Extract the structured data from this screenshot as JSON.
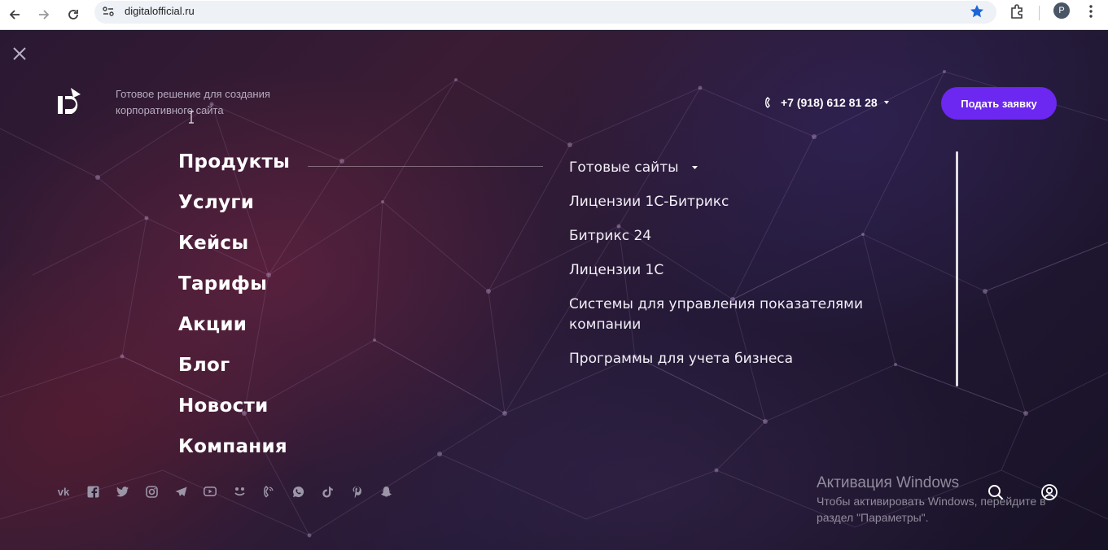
{
  "browser": {
    "url": "digitalofficial.ru",
    "profile_initial": "P"
  },
  "header": {
    "tagline_line1": "Готовое решение для создания",
    "tagline_line2": "корпоративного сайта",
    "phone": "+7 (918) 612 81 28",
    "cta_label": "Подать заявку"
  },
  "main_menu": {
    "items": [
      "Продукты",
      "Услуги",
      "Кейсы",
      "Тарифы",
      "Акции",
      "Блог",
      "Новости",
      "Компания"
    ]
  },
  "sub_menu": {
    "items": [
      "Готовые сайты",
      "Лицензии 1С-Битрикс",
      "Битрикс 24",
      "Лицензии 1С",
      "Системы для управления показателями компании",
      "Программы для учета бизнеса"
    ]
  },
  "socials": {
    "icons": [
      "vk-icon",
      "facebook-icon",
      "twitter-icon",
      "instagram-icon",
      "telegram-icon",
      "youtube-icon",
      "odnoklassniki-icon",
      "viber-icon",
      "whatsapp-icon",
      "tiktok-icon",
      "pinterest-icon",
      "snapchat-icon"
    ],
    "vk_text": "vk"
  },
  "windows_activation": {
    "title": "Активация Windows",
    "line1": "Чтобы активировать Windows, перейдите в",
    "line2": "раздел \"Параметры\"."
  },
  "colors": {
    "accent": "#6c27f0",
    "background": "#1a1226"
  }
}
